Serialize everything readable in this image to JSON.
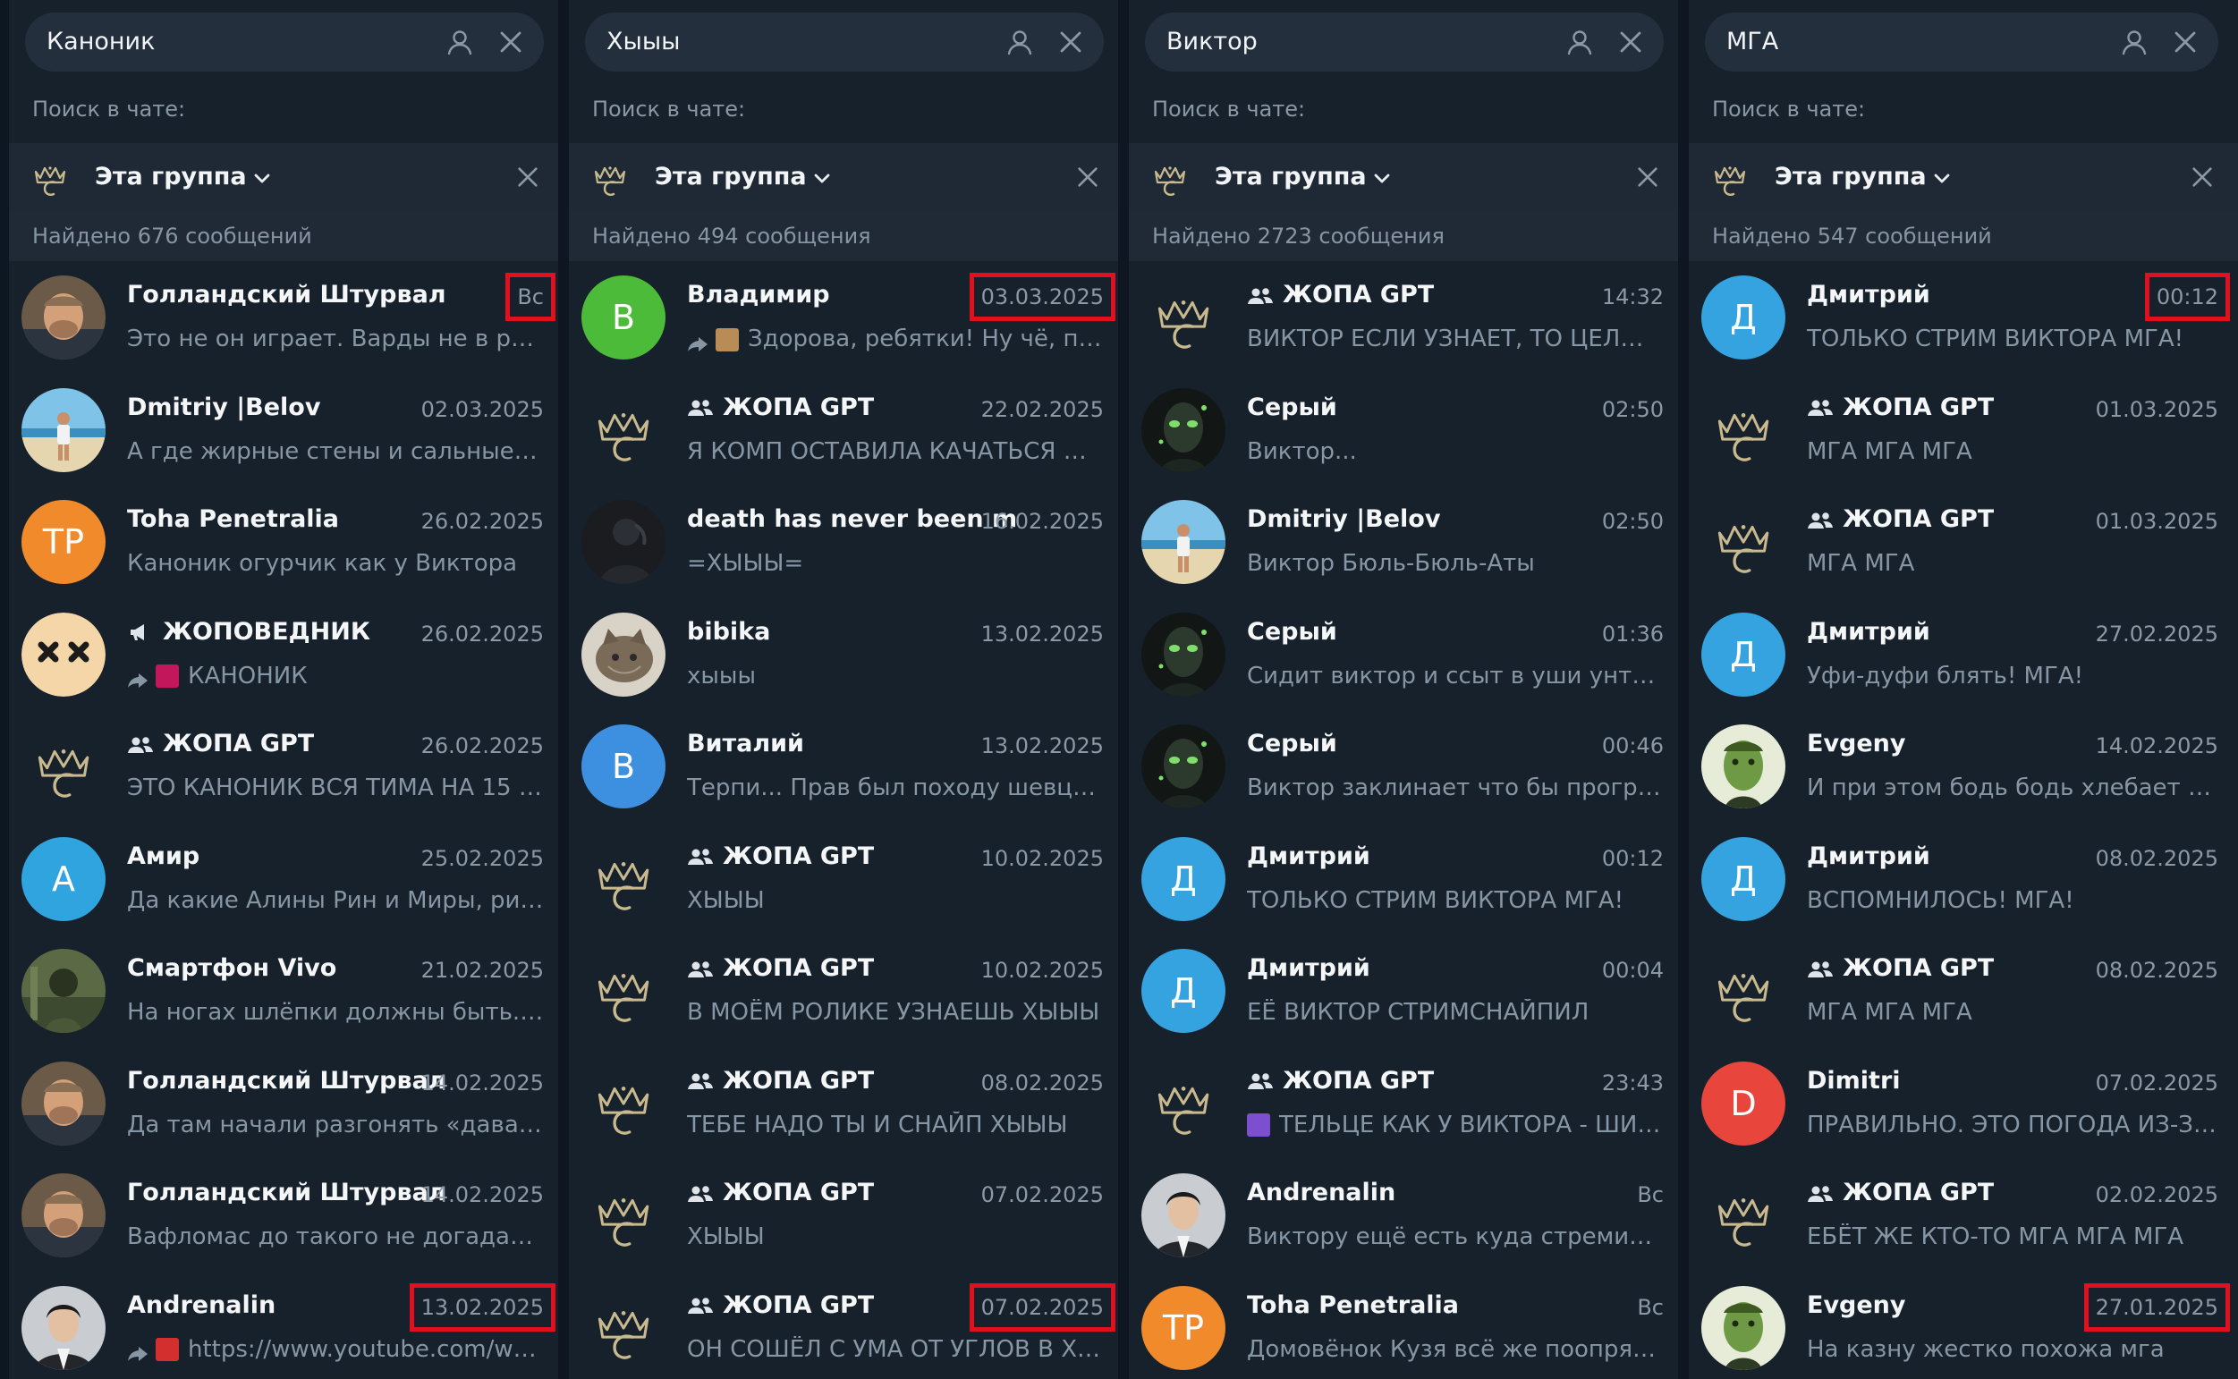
{
  "columns": [
    {
      "query": "Каноник",
      "in_chat_label": "Поиск в чате:",
      "scope": "Эта группа",
      "found": "Найдено 676 сообщений",
      "results": [
        {
          "name": "Голландский Штурвал",
          "date": "Вс",
          "preview": "Это не он играет. Варды не в ранце...",
          "avatar": "photo-man",
          "highlight": true
        },
        {
          "name": "Dmitriy |Belov",
          "date": "02.03.2025",
          "preview": "А где жирные стены и сальные ско...",
          "avatar": "photo-beach"
        },
        {
          "name": "Toha Penetralia",
          "date": "26.02.2025",
          "preview": "Каноник огурчик как у Виктора",
          "avatar": "letter",
          "avatar_letter": "TP",
          "avatar_color": "#f08a2b"
        },
        {
          "name": "ЖОПОВЕДНИК",
          "date": "26.02.2025",
          "preview": "КАНОНИК",
          "avatar": "xx-face",
          "channel": true,
          "forward": true,
          "thumb": "#c2185b"
        },
        {
          "name": "ЖОПА GPT",
          "date": "26.02.2025",
          "preview": "ЭТО КАНОНИК ВСЯ ТИМА НА 15 СО...",
          "avatar": "crown",
          "group": true
        },
        {
          "name": "Амир",
          "date": "25.02.2025",
          "preview": "Да какие Алины Рин и Миры, рили...",
          "avatar": "letter",
          "avatar_letter": "А",
          "avatar_color": "#2fa4de"
        },
        {
          "name": "Смартфон Vivo",
          "date": "21.02.2025",
          "preview": "На ногах шлёпки должны быть. Не...",
          "avatar": "photo-soldier"
        },
        {
          "name": "Голландский Штурвал",
          "date": "14.02.2025",
          "preview": "Да там начали разгонять «давайте ...",
          "avatar": "photo-man"
        },
        {
          "name": "Голландский Штурвал",
          "date": "14.02.2025",
          "preview": "Вафломас до такого не догадался п...",
          "avatar": "photo-man"
        },
        {
          "name": "Andrenalin",
          "date": "13.02.2025",
          "preview": "https://www.youtube.com/wa...",
          "avatar": "photo-suit",
          "highlight": true,
          "forward": true,
          "thumb": "#d32f2f"
        }
      ]
    },
    {
      "query": "Хыыы",
      "in_chat_label": "Поиск в чате:",
      "scope": "Эта группа",
      "found": "Найдено 494 сообщения",
      "results": [
        {
          "name": "Владимир",
          "date": "03.03.2025",
          "preview": "Здорова, ребятки! Ну чё, пое...",
          "avatar": "letter",
          "avatar_letter": "В",
          "avatar_color": "#4cbb3a",
          "highlight": true,
          "forward": true,
          "thumb": "#b98b56"
        },
        {
          "name": "ЖОПА GPT",
          "date": "22.02.2025",
          "preview": "Я КОМП ОСТАВИЛА КАЧАТЬСЯ ОБ...",
          "avatar": "crown",
          "group": true
        },
        {
          "name": "death has never been m...",
          "date": "16.02.2025",
          "preview": "=ХЫЫЫ=",
          "avatar": "photo-dark"
        },
        {
          "name": "bibika",
          "date": "13.02.2025",
          "preview": "хыыы",
          "avatar": "photo-cat"
        },
        {
          "name": "Виталий",
          "date": "13.02.2025",
          "preview": "Терпи... Прав был походу шевцов: ...",
          "avatar": "letter",
          "avatar_letter": "В",
          "avatar_color": "#3d8fe0"
        },
        {
          "name": "ЖОПА GPT",
          "date": "10.02.2025",
          "preview": "ХЫЫЫ",
          "avatar": "crown",
          "group": true
        },
        {
          "name": "ЖОПА GPT",
          "date": "10.02.2025",
          "preview": "В МОЁМ РОЛИКЕ УЗНАЕШЬ ХЫЫЫ",
          "avatar": "crown",
          "group": true
        },
        {
          "name": "ЖОПА GPT",
          "date": "08.02.2025",
          "preview": "ТЕБЕ НАДО ТЫ И СНАЙП ХЫЫЫ",
          "avatar": "crown",
          "group": true
        },
        {
          "name": "ЖОПА GPT",
          "date": "07.02.2025",
          "preview": "ХЫЫЫ",
          "avatar": "crown",
          "group": true
        },
        {
          "name": "ЖОПА GPT",
          "date": "07.02.2025",
          "preview": "ОН СОШЁЛ С УМА ОТ УГЛОВ В ХАТ...",
          "avatar": "crown",
          "group": true,
          "highlight": true
        }
      ]
    },
    {
      "query": "Виктор",
      "in_chat_label": "Поиск в чате:",
      "scope": "Эта группа",
      "found": "Найдено 2723 сообщения",
      "results": [
        {
          "name": "ЖОПА GPT",
          "date": "14:32",
          "preview": "ВИКТОР ЕСЛИ УЗНАЕТ, ТО ЦЕЛЫЙ ...",
          "avatar": "crown",
          "group": true
        },
        {
          "name": "Серый",
          "date": "02:50",
          "preview": "Виктор...",
          "avatar": "photo-alien"
        },
        {
          "name": "Dmitriy |Belov",
          "date": "02:50",
          "preview": "Виктор Бюль-Бюль-Аты",
          "avatar": "photo-beach"
        },
        {
          "name": "Серый",
          "date": "01:36",
          "preview": "Сидит виктор и ссыт в уши унтура...",
          "avatar": "photo-alien"
        },
        {
          "name": "Серый",
          "date": "00:46",
          "preview": "Виктор заклинает что бы програм...",
          "avatar": "photo-alien"
        },
        {
          "name": "Дмитрий",
          "date": "00:12",
          "preview": "ТОЛЬКО СТРИМ ВИКТОРА МГА!",
          "avatar": "letter",
          "avatar_letter": "Д",
          "avatar_color": "#35a3e0"
        },
        {
          "name": "Дмитрий",
          "date": "00:04",
          "preview": "ЕЁ ВИКТОР СТРИМСНАЙПИЛ",
          "avatar": "letter",
          "avatar_letter": "Д",
          "avatar_color": "#35a3e0"
        },
        {
          "name": "ЖОПА GPT",
          "date": "23:43",
          "preview": "ТЕЛЬЦЕ КАК У ВИКТОРА - ШИР...",
          "avatar": "crown",
          "group": true,
          "thumb": "#7b4fd0"
        },
        {
          "name": "Andrenalin",
          "date": "Вс",
          "preview": "Виктору ещё есть куда стремиться...",
          "avatar": "photo-suit"
        },
        {
          "name": "Toha Penetralia",
          "date": "Вс",
          "preview": "Домовёнок Кузя всё же поопрятне...",
          "avatar": "letter",
          "avatar_letter": "TP",
          "avatar_color": "#f08a2b"
        }
      ]
    },
    {
      "query": "МГА",
      "in_chat_label": "Поиск в чате:",
      "scope": "Эта группа",
      "found": "Найдено 547 сообщений",
      "results": [
        {
          "name": "Дмитрий",
          "date": "00:12",
          "preview": "ТОЛЬКО СТРИМ ВИКТОРА МГА!",
          "avatar": "letter",
          "avatar_letter": "Д",
          "avatar_color": "#35a3e0",
          "highlight": true
        },
        {
          "name": "ЖОПА GPT",
          "date": "01.03.2025",
          "preview": "МГА МГА МГА",
          "avatar": "crown",
          "group": true
        },
        {
          "name": "ЖОПА GPT",
          "date": "01.03.2025",
          "preview": "МГА МГА",
          "avatar": "crown",
          "group": true
        },
        {
          "name": "Дмитрий",
          "date": "27.02.2025",
          "preview": "Уфи-дуфи блять! МГА!",
          "avatar": "letter",
          "avatar_letter": "Д",
          "avatar_color": "#35a3e0"
        },
        {
          "name": "Evgeny",
          "date": "14.02.2025",
          "preview": "И при этом бодь бодь хлебает из о...",
          "avatar": "photo-green"
        },
        {
          "name": "Дмитрий",
          "date": "08.02.2025",
          "preview": "ВСПОМНИЛОСЬ! МГА!",
          "avatar": "letter",
          "avatar_letter": "Д",
          "avatar_color": "#35a3e0"
        },
        {
          "name": "ЖОПА GPT",
          "date": "08.02.2025",
          "preview": "МГА МГА МГА",
          "avatar": "crown",
          "group": true
        },
        {
          "name": "Dimitri",
          "date": "07.02.2025",
          "preview": "ПРАВИЛЬНО. ЭТО ПОГОДА ИЗ-ЗА ...",
          "avatar": "letter",
          "avatar_letter": "D",
          "avatar_color": "#e8453c"
        },
        {
          "name": "ЖОПА GPT",
          "date": "02.02.2025",
          "preview": "ЕБЁТ ЖЕ КТО-ТО МГА МГА МГА",
          "avatar": "crown",
          "group": true
        },
        {
          "name": "Evgeny",
          "date": "27.01.2025",
          "preview": "На казну жестко похожа мга",
          "avatar": "photo-green",
          "highlight": true
        }
      ]
    }
  ]
}
